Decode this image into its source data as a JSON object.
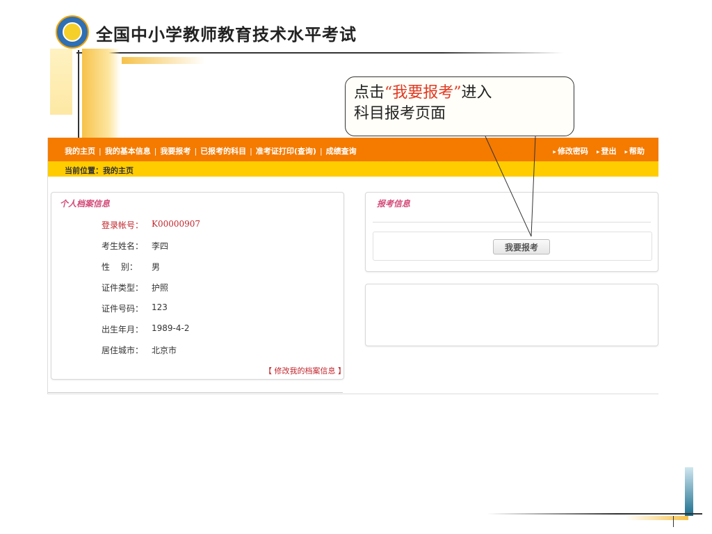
{
  "slide": {
    "title": "全国中小学教师教育技术水平考试",
    "callout": {
      "prefix": "点击",
      "highlight": "“我要报考”",
      "suffix": "进入",
      "line2": "科目报考页面"
    }
  },
  "site": {
    "nav": {
      "items": [
        "我的主页",
        "我的基本信息",
        "我要报考",
        "已报考的科目",
        "准考证打印(查询)",
        "成绩查询"
      ],
      "right_items": [
        "修改密码",
        "登出",
        "帮助"
      ]
    },
    "breadcrumb": "当前位置：我的主页",
    "profile": {
      "title": "个人档案信息",
      "fields": [
        {
          "label": "登录帐号：",
          "value": "K00000907"
        },
        {
          "label": "考生姓名：",
          "value": "李四"
        },
        {
          "label": "性　 别：",
          "value": "男"
        },
        {
          "label": "证件类型：",
          "value": "护照"
        },
        {
          "label": "证件号码：",
          "value": "123"
        },
        {
          "label": "出生年月：",
          "value": "1989-4-2"
        },
        {
          "label": "居住城市：",
          "value": "北京市"
        }
      ],
      "edit_link": "【 修改我的档案信息 】"
    },
    "exam": {
      "title": "报考信息",
      "apply_button": "我要报考"
    }
  }
}
